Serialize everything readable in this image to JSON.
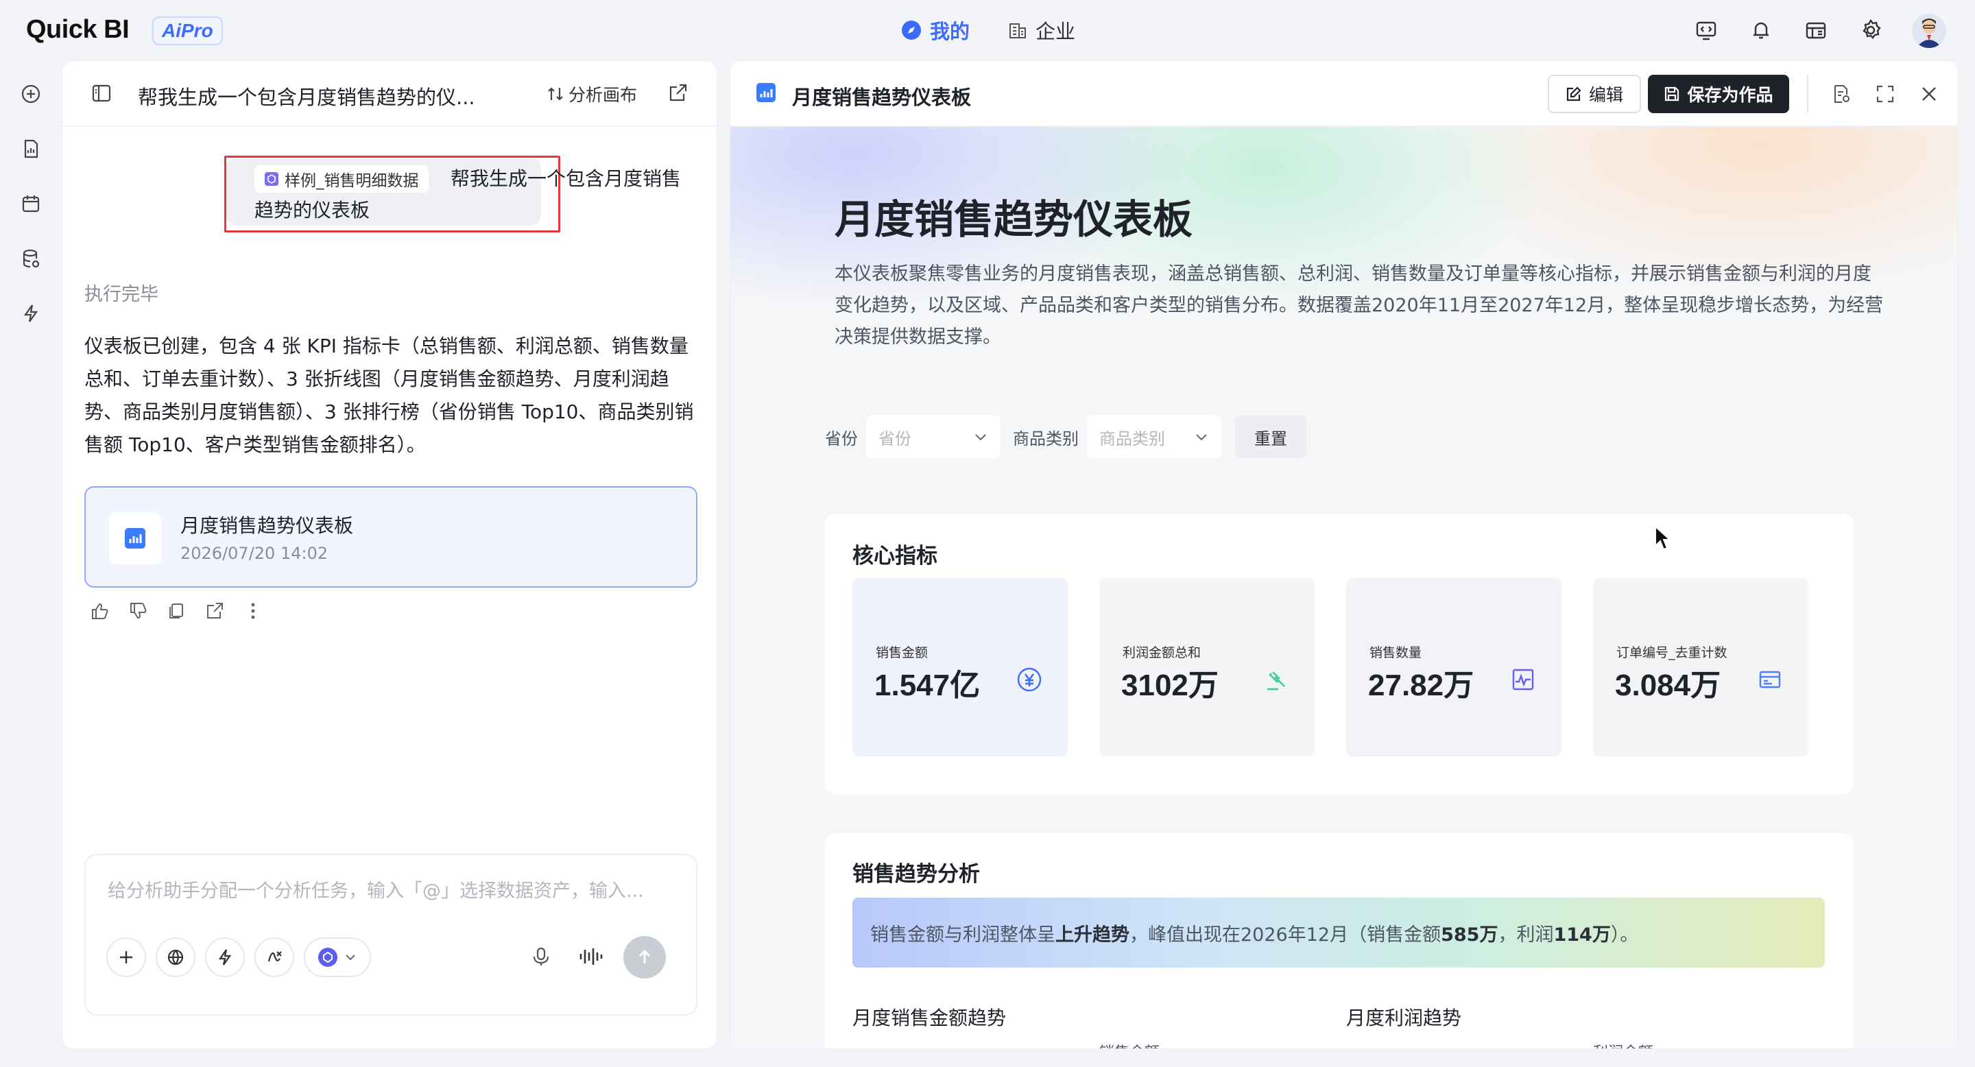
{
  "app": {
    "logo": "Quick BI",
    "badge": "AiPro"
  },
  "topnav": {
    "mine": "我的",
    "enterprise": "企业"
  },
  "chat": {
    "title": "帮我生成一个包含月度销售趋势的仪...",
    "analysis_canvas": "分析画布",
    "dataset_chip": "样例_销售明细数据",
    "user_message_line1": "帮我生成一个包含月度销售",
    "user_message_line2": "趋势的仪表板",
    "status": "执行完毕",
    "answer": "仪表板已创建，包含 4 张 KPI 指标卡（总销售额、利润总额、销售数量总和、订单去重计数）、3 张折线图（月度销售金额趋势、月度利润趋势、商品类别月度销售额）、3 张排行榜（省份销售 Top10、商品类别销售额 Top10、客户类型销售金额排名）。",
    "artifact": {
      "title": "月度销售趋势仪表板",
      "date": "2026/07/20 14:02"
    },
    "input_placeholder": "给分析助手分配一个分析任务，输入「@」选择数据资产，输入..."
  },
  "preview": {
    "title": "月度销售趋势仪表板",
    "edit_label": "编辑",
    "save_label": "保存为作品",
    "dashboard": {
      "title": "月度销售趋势仪表板",
      "description": "本仪表板聚焦零售业务的月度销售表现，涵盖总销售额、总利润、销售数量及订单量等核心指标，并展示销售金额与利润的月度变化趋势，以及区域、产品品类和客户类型的销售分布。数据覆盖2020年11月至2027年12月，整体呈现稳步增长态势，为经营决策提供数据支撑。",
      "filters": {
        "province_label": "省份",
        "province_placeholder": "省份",
        "category_label": "商品类别",
        "category_placeholder": "商品类别",
        "reset_label": "重置"
      },
      "kpi_heading": "核心指标",
      "kpis": [
        {
          "label": "销售金额",
          "value": "1.547亿",
          "icon": "yuan-icon"
        },
        {
          "label": "利润金额总和",
          "value": "3102万",
          "icon": "auction-hammer-icon"
        },
        {
          "label": "销售数量",
          "value": "27.82万",
          "icon": "pulse-chart-icon"
        },
        {
          "label": "订单编号_去重计数",
          "value": "3.084万",
          "icon": "card-icon"
        }
      ],
      "trend_heading": "销售趋势分析",
      "insight": {
        "part1": "销售金额与利润整体呈",
        "bold1": "上升趋势",
        "part2": "，峰值出现在2026年12月（销售金额",
        "bold2": "585万",
        "part3": "，利润",
        "bold3": "114万",
        "part4": "）。"
      },
      "chart1_title": "月度销售金额趋势",
      "chart1_legend": "销售金额",
      "chart2_title": "月度利润趋势",
      "chart2_legend": "利润金额"
    }
  },
  "colors": {
    "accent": "#3b6cff",
    "highlight_border": "#e03a3a",
    "kpi_icon_blue": "#3b6cff",
    "kpi_icon_green": "#2fcf9b",
    "kpi_icon_purple": "#6a5cf0",
    "kpi_icon_indigo": "#4f7dff"
  }
}
